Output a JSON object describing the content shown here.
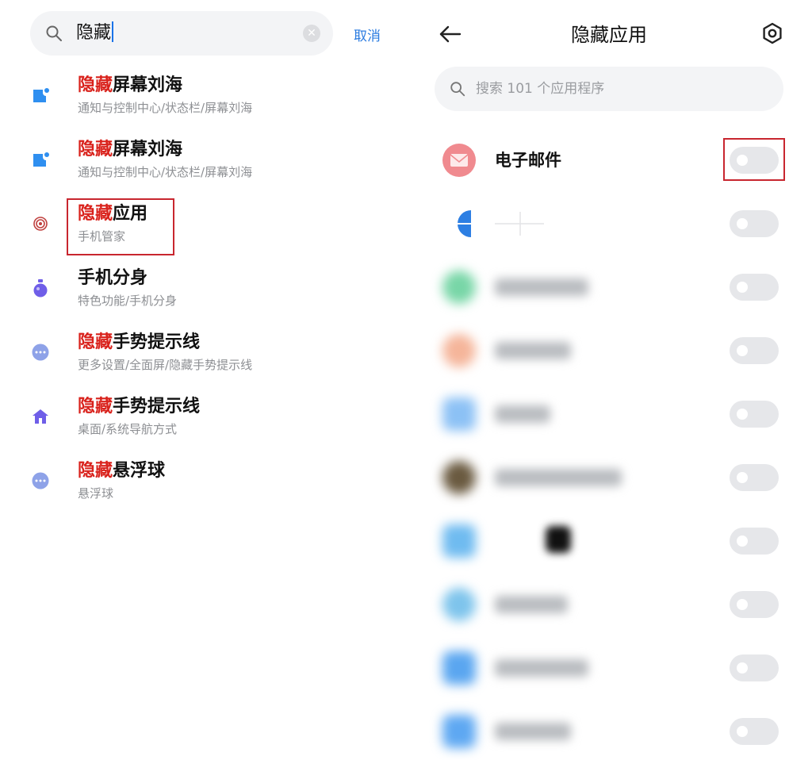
{
  "left": {
    "search": {
      "query": "隐藏",
      "cancel_label": "取消"
    },
    "results": [
      {
        "highlight": "隐藏",
        "rest": "屏幕刘海",
        "subtitle": "通知与控制中心/状态栏/屏幕刘海",
        "icon": "notification-icon",
        "color": "#2f8ff0"
      },
      {
        "highlight": "隐藏",
        "rest": "屏幕刘海",
        "subtitle": "通知与控制中心/状态栏/屏幕刘海",
        "icon": "notification-icon",
        "color": "#2f8ff0"
      },
      {
        "highlight": "隐藏",
        "rest": "应用",
        "subtitle": "手机管家",
        "icon": "target-icon",
        "color": "#c0413f"
      },
      {
        "highlight": "",
        "rest": "手机分身",
        "subtitle": "特色功能/手机分身",
        "icon": "flask-icon",
        "color": "#6f5ee8"
      },
      {
        "highlight": "隐藏",
        "rest": "手势提示线",
        "subtitle": "更多设置/全面屏/隐藏手势提示线",
        "icon": "more-icon",
        "color": "#8ea2e8"
      },
      {
        "highlight": "隐藏",
        "rest": "手势提示线",
        "subtitle": "桌面/系统导航方式",
        "icon": "home-icon",
        "color": "#6f5ee8"
      },
      {
        "highlight": "隐藏",
        "rest": "悬浮球",
        "subtitle": "悬浮球",
        "icon": "more-icon",
        "color": "#8ea2e8"
      }
    ]
  },
  "right": {
    "title": "隐藏应用",
    "search_placeholder": "搜索 101 个应用程序",
    "apps": [
      {
        "name": "电子邮件",
        "icon": "email-icon",
        "icon_color": "#f08a8f",
        "enabled": false,
        "blurred": false
      },
      {
        "name": "",
        "icon": "app-icon",
        "icon_color": "#2d7fe3",
        "enabled": false,
        "blurred": false
      },
      {
        "name": "",
        "icon": "app-icon",
        "icon_color": "#78d6a7",
        "enabled": false,
        "blurred": true
      },
      {
        "name": "",
        "icon": "app-icon",
        "icon_color": "#f5b59a",
        "enabled": false,
        "blurred": true
      },
      {
        "name": "",
        "icon": "app-icon",
        "icon_color": "#8cc1f5",
        "enabled": false,
        "blurred": true
      },
      {
        "name": "",
        "icon": "app-icon",
        "icon_color": "#6a5a40",
        "enabled": false,
        "blurred": true
      },
      {
        "name": "",
        "icon": "app-icon",
        "icon_color": "#6fbbf0",
        "enabled": false,
        "blurred": true
      },
      {
        "name": "",
        "icon": "app-icon",
        "icon_color": "#7ec4ec",
        "enabled": false,
        "blurred": true
      },
      {
        "name": "",
        "icon": "app-icon",
        "icon_color": "#5aa6f0",
        "enabled": false,
        "blurred": true
      },
      {
        "name": "",
        "icon": "app-icon",
        "icon_color": "#5ea8f2",
        "enabled": false,
        "blurred": true
      }
    ]
  }
}
